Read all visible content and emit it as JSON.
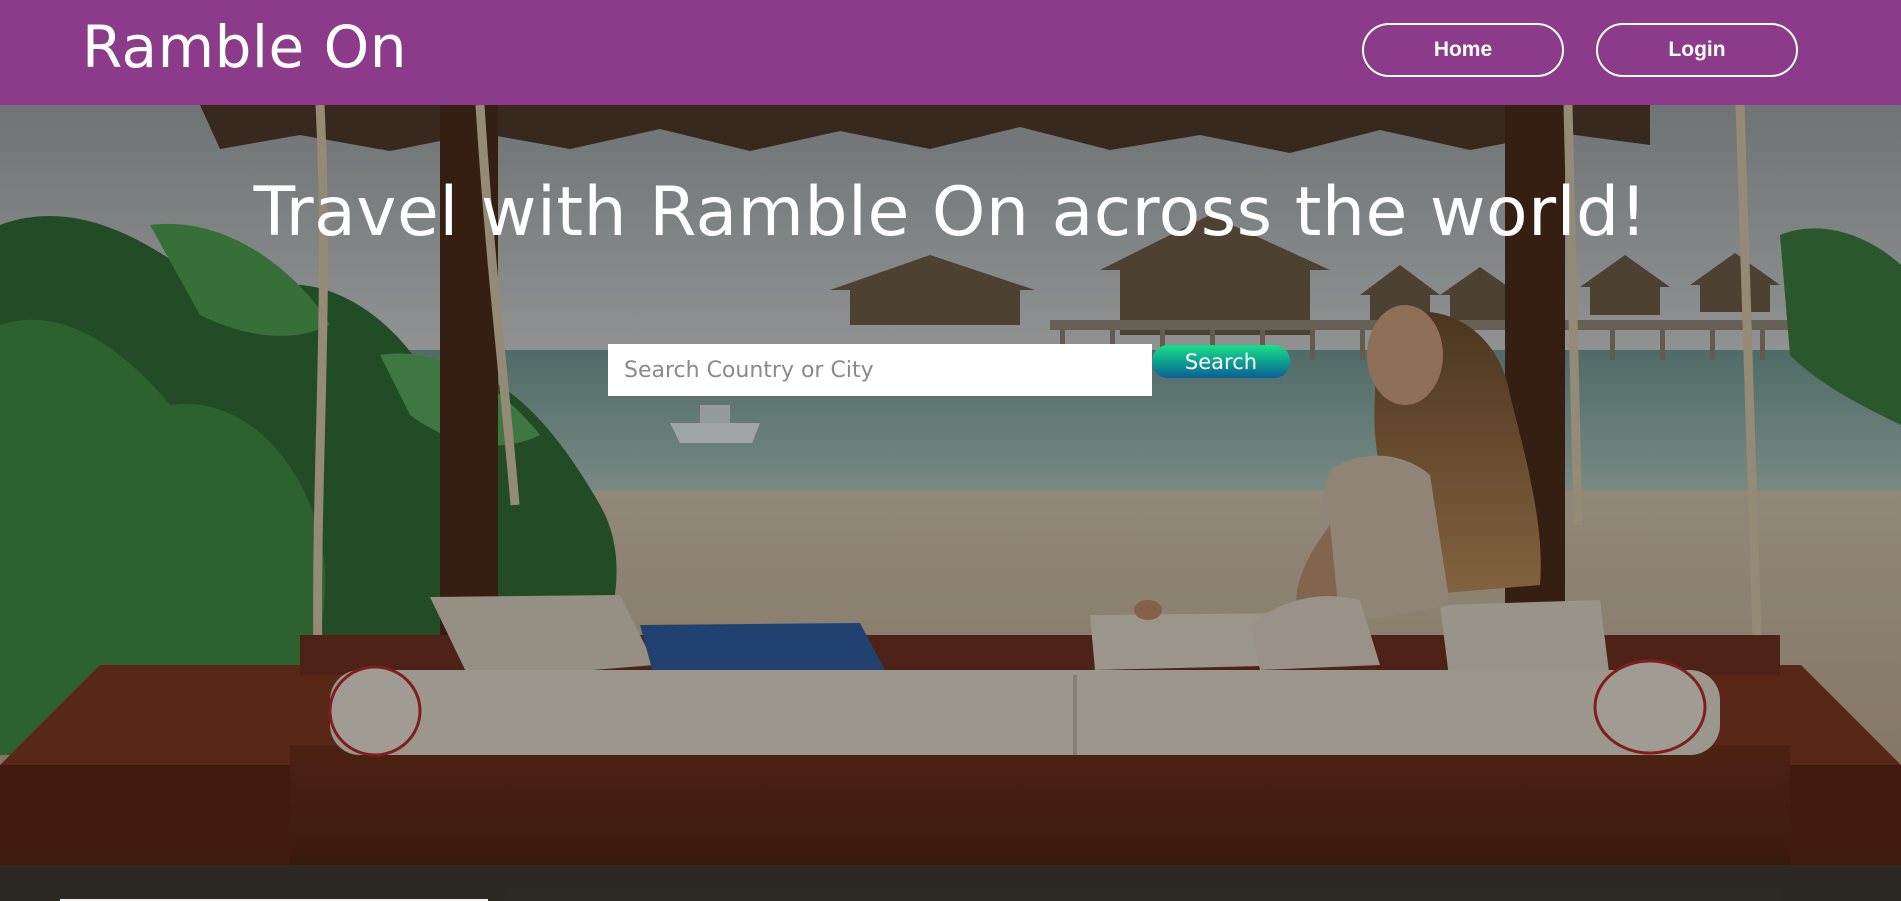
{
  "header": {
    "brand": "Ramble On",
    "nav": {
      "home_label": "Home",
      "login_label": "Login"
    },
    "background_color": "#8b3b8a"
  },
  "hero": {
    "headline": "Travel with Ramble On across the world!",
    "background_image": "tropical-beach-swing-bed-photo",
    "search": {
      "placeholder": "Search Country or City",
      "value": "",
      "button_label": "Search"
    }
  }
}
